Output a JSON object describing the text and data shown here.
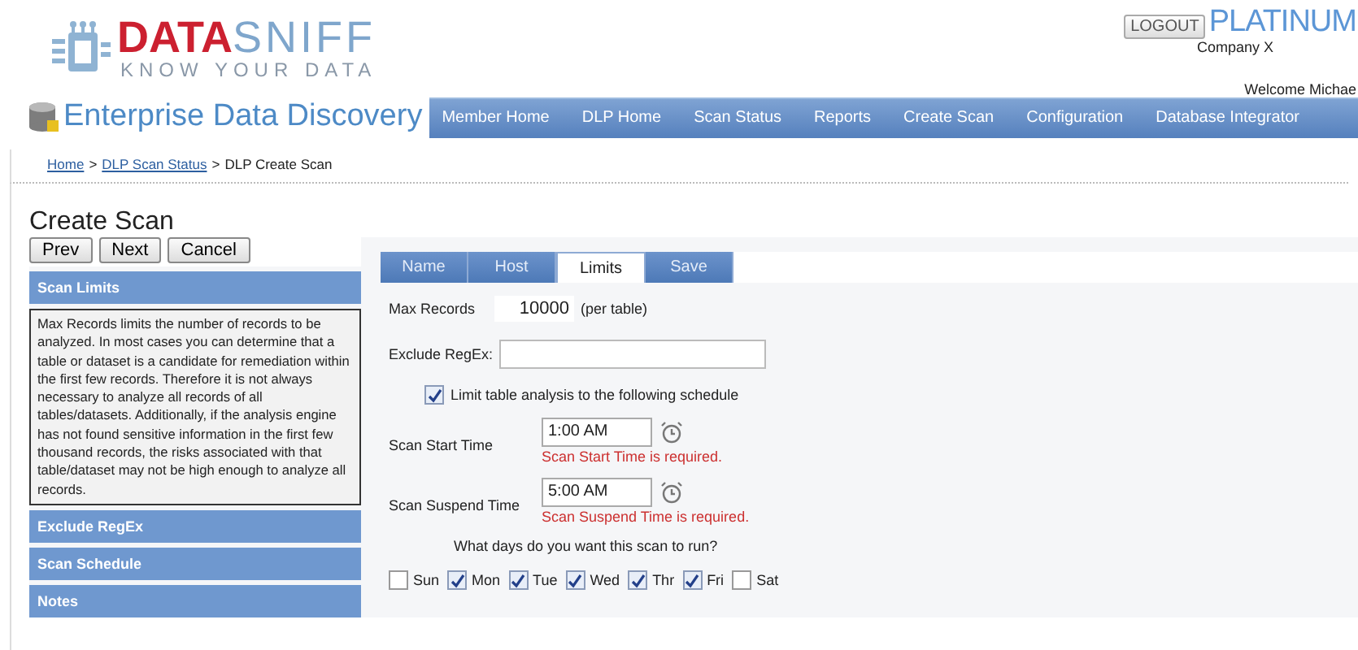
{
  "header": {
    "logo": {
      "word_1": "DATA",
      "word_2": "SNIFF",
      "tagline": "KNOW YOUR DATA"
    },
    "logout": "LOGOUT",
    "plan": "PLATINUM",
    "company": "Company X",
    "welcome": "Welcome Michae"
  },
  "app_title": "Enterprise Data Discovery",
  "nav": [
    {
      "label": "Member Home"
    },
    {
      "label": "DLP Home"
    },
    {
      "label": "Scan Status"
    },
    {
      "label": "Reports"
    },
    {
      "label": "Create Scan"
    },
    {
      "label": "Configuration"
    },
    {
      "label": "Database Integrator"
    }
  ],
  "breadcrumb": {
    "separator": ">",
    "items": [
      {
        "label": "Home",
        "kind": "link"
      },
      {
        "label": "DLP Scan Status",
        "kind": "link"
      },
      {
        "label": "DLP Create Scan",
        "kind": "current"
      }
    ]
  },
  "page_title": "Create Scan",
  "buttons": [
    "Prev",
    "Next",
    "Cancel"
  ],
  "accordion": [
    {
      "title": "Scan Limits",
      "body": "Max Records limits the number of records to be analyzed. In most cases you can determine that a table or dataset is a candidate for remediation within the first few records. Therefore it is not always necessary to analyze all records of all tables/datasets. Additionally, if the analysis engine has not found sensitive information in the first few thousand records, the risks associated with that table/dataset may not be high enough to analyze all records."
    },
    {
      "title": "Exclude RegEx"
    },
    {
      "title": "Scan Schedule"
    },
    {
      "title": "Notes"
    }
  ],
  "tabs": [
    {
      "label": "Name",
      "selected": false
    },
    {
      "label": "Host",
      "selected": false
    },
    {
      "label": "Limits",
      "selected": true
    },
    {
      "label": "Save",
      "selected": false
    }
  ],
  "form": {
    "max_records": {
      "label": "Max Records",
      "value": "10000",
      "suffix": "(per table)"
    },
    "exclude_regex": {
      "label": "Exclude RegEx:"
    },
    "limit_schedule": {
      "label": "Limit table analysis to the following schedule",
      "checked": true
    },
    "times": [
      {
        "label": "Scan Start Time",
        "value": "1:00 AM",
        "error": "Scan Start Time is required."
      },
      {
        "label": "Scan Suspend Time",
        "value": "5:00 AM",
        "error": "Scan Suspend Time is required."
      }
    ],
    "days_question": "What days do you want this scan to run?",
    "days": [
      {
        "label": "Sun",
        "checked": false
      },
      {
        "label": "Mon",
        "checked": true
      },
      {
        "label": "Tue",
        "checked": true
      },
      {
        "label": "Wed",
        "checked": true
      },
      {
        "label": "Thr",
        "checked": true
      },
      {
        "label": "Fri",
        "checked": true
      },
      {
        "label": "Sat",
        "checked": false
      }
    ]
  }
}
